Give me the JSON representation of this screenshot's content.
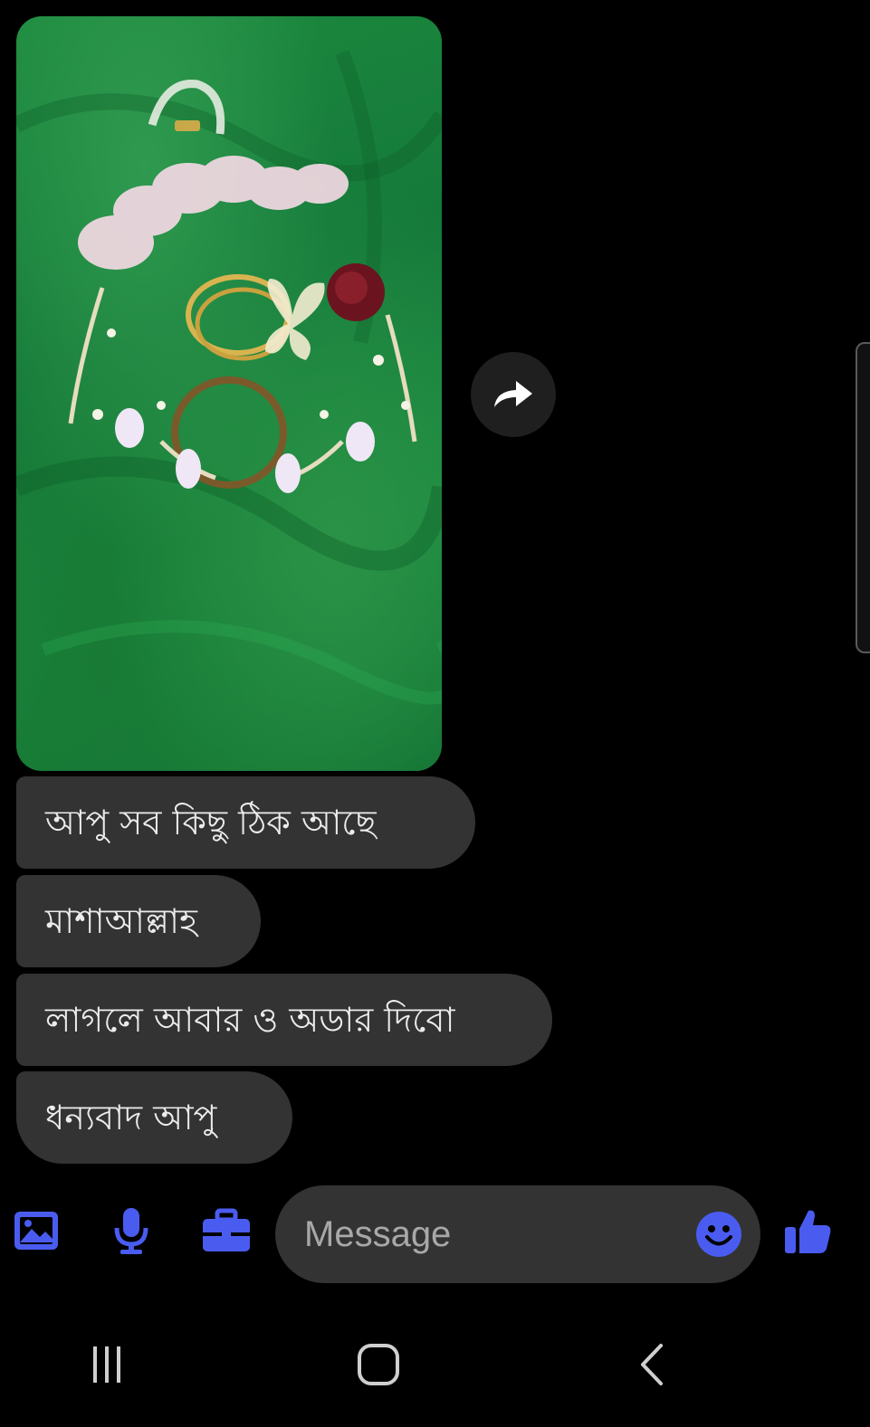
{
  "colors": {
    "background": "#000000",
    "bubble": "#333333",
    "accent": "#4a5cf0",
    "nav_icon": "#cfcfcf"
  },
  "conversation": {
    "photo_message": {
      "icon": "image-photo"
    },
    "forward_action": {
      "icon": "forward-arrow-icon"
    },
    "messages": [
      {
        "text": "আপু সব কিছু ঠিক আছে"
      },
      {
        "text": "মাশাআল্লাহ"
      },
      {
        "text": "লাগলে আবার ও অডার দিবো"
      },
      {
        "text": "ধন্যবাদ আপু"
      }
    ]
  },
  "composer": {
    "gallery_icon": "gallery-icon",
    "mic_icon": "microphone-icon",
    "toolbox_icon": "briefcase-icon",
    "placeholder": "Message",
    "emoji_icon": "emoji-icon",
    "like_icon": "thumbs-up-icon"
  },
  "system_nav": {
    "recents_icon": "recents-icon",
    "home_icon": "home-icon",
    "back_icon": "back-icon"
  }
}
